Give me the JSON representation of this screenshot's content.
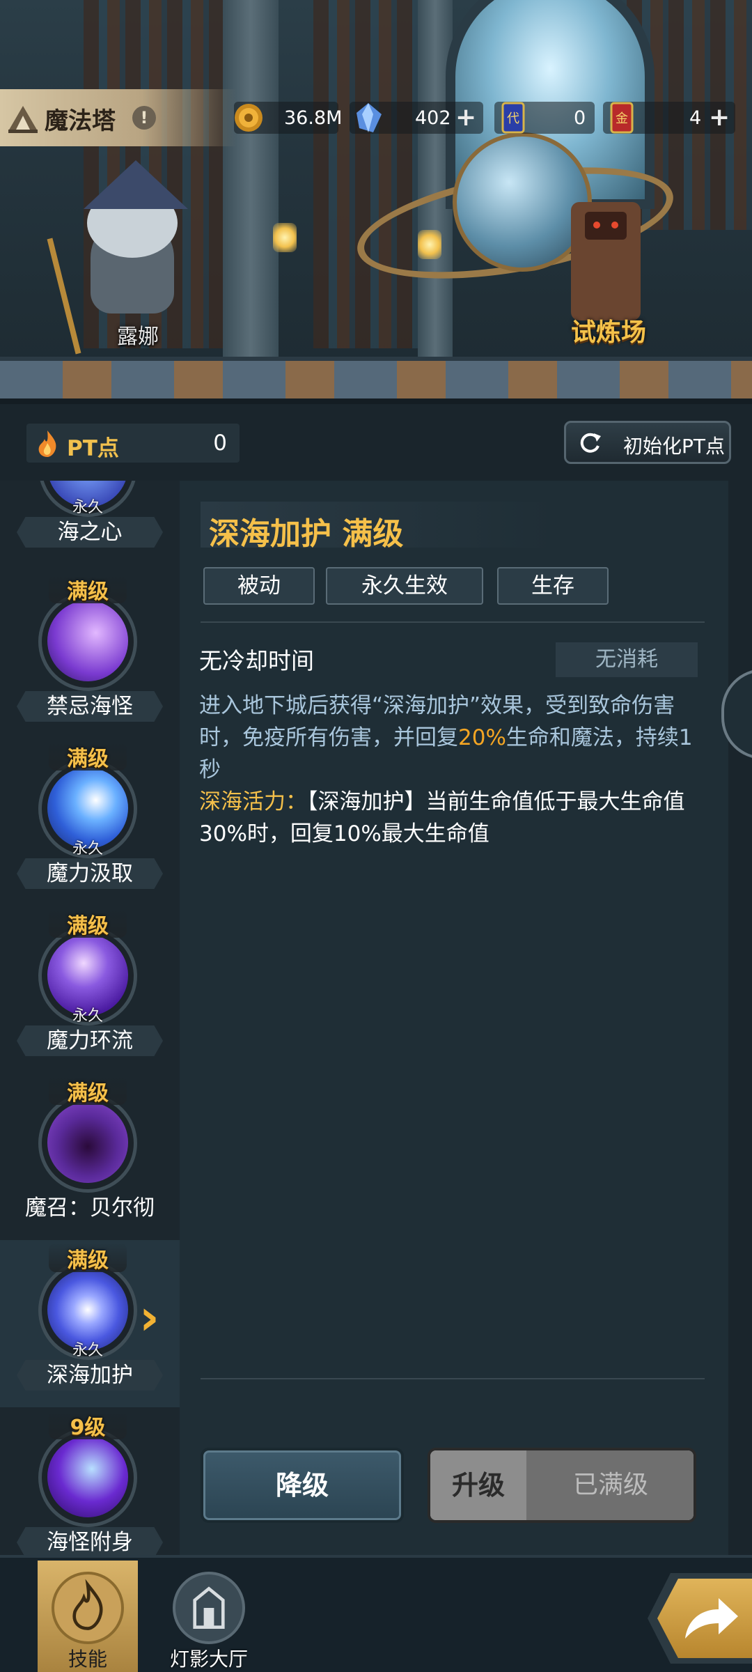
{
  "header": {
    "title": "魔法塔",
    "info_icon": "!",
    "resources": [
      {
        "icon": "coin-icon",
        "value": "36.8M",
        "has_plus": false
      },
      {
        "icon": "crystal-icon",
        "value": "402",
        "has_plus": true
      },
      {
        "icon": "blue-card-icon",
        "value": "0",
        "has_plus": false
      },
      {
        "icon": "red-card-icon",
        "value": "4",
        "has_plus": true
      }
    ]
  },
  "scene": {
    "character_name": "露娜",
    "trial_label": "试炼场"
  },
  "pt": {
    "label": "PT点",
    "value": "0",
    "reset_label": "初始化PT点"
  },
  "skills": [
    {
      "name": "海之心",
      "level": "",
      "permanent": "永久",
      "color": "#3a4ab8"
    },
    {
      "name": "禁忌海怪",
      "level": "满级",
      "permanent": "",
      "color": "#7a3ad0"
    },
    {
      "name": "魔力汲取",
      "level": "满级",
      "permanent": "永久",
      "color": "#2f5fd8"
    },
    {
      "name": "魔力环流",
      "level": "满级",
      "permanent": "永久",
      "color": "#6a3ae0"
    },
    {
      "name": "魔召：贝尔彻",
      "level": "满级",
      "permanent": "",
      "color": "#5a2a9a"
    },
    {
      "name": "深海加护",
      "level": "满级",
      "permanent": "永久",
      "color": "#4a58e0",
      "active": true
    },
    {
      "name": "海怪附身",
      "level": "9级",
      "permanent": "",
      "color": "#6a2ad0"
    }
  ],
  "detail": {
    "title": "深海加护 满级",
    "tags": [
      "被动",
      "永久生效",
      "生存"
    ],
    "cooldown": "无冷却时间",
    "cost": "无消耗",
    "desc_part1": "进入地下城后获得“深海加护”效果，受到致命伤害时，免疫所有伤害，并回复",
    "desc_highlight": "20%",
    "desc_part2": "生命和魔法，持续1秒",
    "bonus_label": "深海活力：",
    "bonus_text": "【深海加护】当前生命值低于最大生命值30%时，回复10%最大生命值",
    "downgrade_label": "降级",
    "upgrade_label": "升级",
    "maxed_label": "已满级"
  },
  "nav": {
    "items": [
      {
        "label": "技能",
        "active": true
      },
      {
        "label": "灯影大厅",
        "active": false
      }
    ]
  },
  "colors": {
    "gold": "#f5c04a",
    "accent_orange": "#f5a623",
    "panel_bg": "#1f2e36"
  }
}
